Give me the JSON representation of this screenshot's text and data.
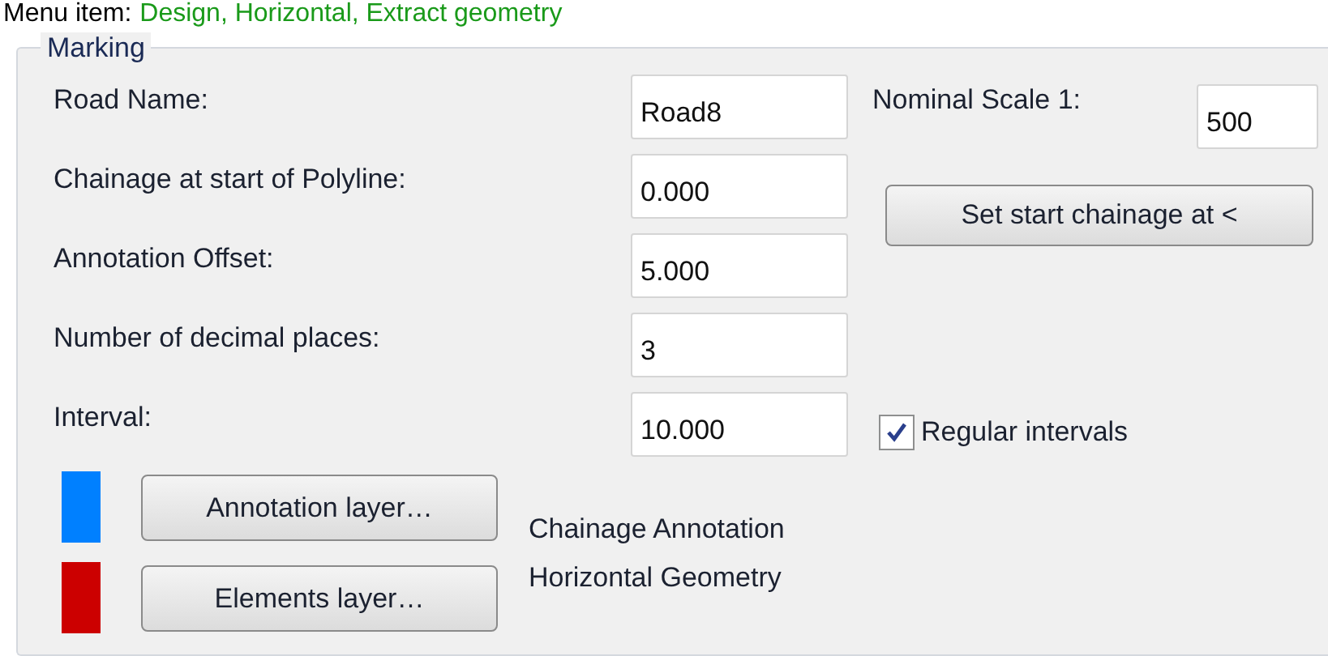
{
  "menu_item": {
    "label": "Menu item:",
    "value": "Design, Horizontal, Extract geometry"
  },
  "group": {
    "title": "Marking"
  },
  "fields": [
    {
      "label": "Road Name:",
      "value": "Road8"
    },
    {
      "label": "Chainage at start of Polyline:",
      "value": "0.000"
    },
    {
      "label": "Annotation Offset:",
      "value": "5.000"
    },
    {
      "label": "Number of decimal places:",
      "value": "3"
    },
    {
      "label": "Interval:",
      "value": "10.000"
    }
  ],
  "nominal_scale": {
    "label": "Nominal Scale 1:",
    "value": "500"
  },
  "set_start_button": "Set start chainage at <",
  "regular_intervals": {
    "label": "Regular intervals",
    "checked": true
  },
  "layers": [
    {
      "color": "#0080ff",
      "button": "Annotation layer…",
      "name": "Chainage Annotation"
    },
    {
      "color": "#cc0000",
      "button": "Elements layer…",
      "name": "Horizontal Geometry"
    }
  ]
}
